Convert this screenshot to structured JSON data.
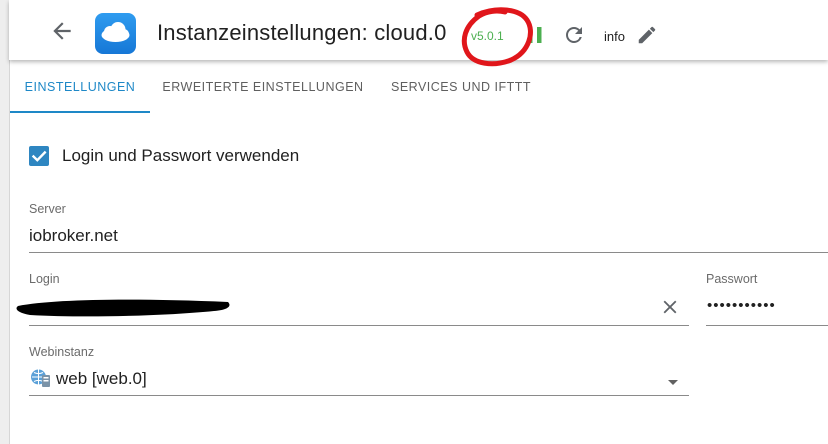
{
  "header": {
    "title": "Instanzeinstellungen: cloud.0",
    "version": "v5.0.1",
    "info_label": "info",
    "icons": {
      "back": "arrow-back-icon",
      "logo": "cloud-icon",
      "pause": "pause-icon",
      "reload": "reload-icon",
      "edit": "pencil-icon"
    }
  },
  "tabs": [
    {
      "label": "EINSTELLUNGEN",
      "active": true
    },
    {
      "label": "ERWEITERTE EINSTELLUNGEN",
      "active": false
    },
    {
      "label": "SERVICES UND IFTTT",
      "active": false
    }
  ],
  "form": {
    "use_login": {
      "label": "Login und Passwort verwenden",
      "checked": true
    },
    "server": {
      "label": "Server",
      "value": "iobroker.net"
    },
    "login": {
      "label": "Login",
      "value": ""
    },
    "password": {
      "label": "Passwort",
      "value": "•••••••••••"
    },
    "webinstance": {
      "label": "Webinstanz",
      "value": "web [web.0]"
    }
  },
  "colors": {
    "accent": "#1e88c7",
    "checkbox": "#2e86c1",
    "version": "#4caf50",
    "pause": "#4caf50",
    "annotation": "#e0161b"
  }
}
